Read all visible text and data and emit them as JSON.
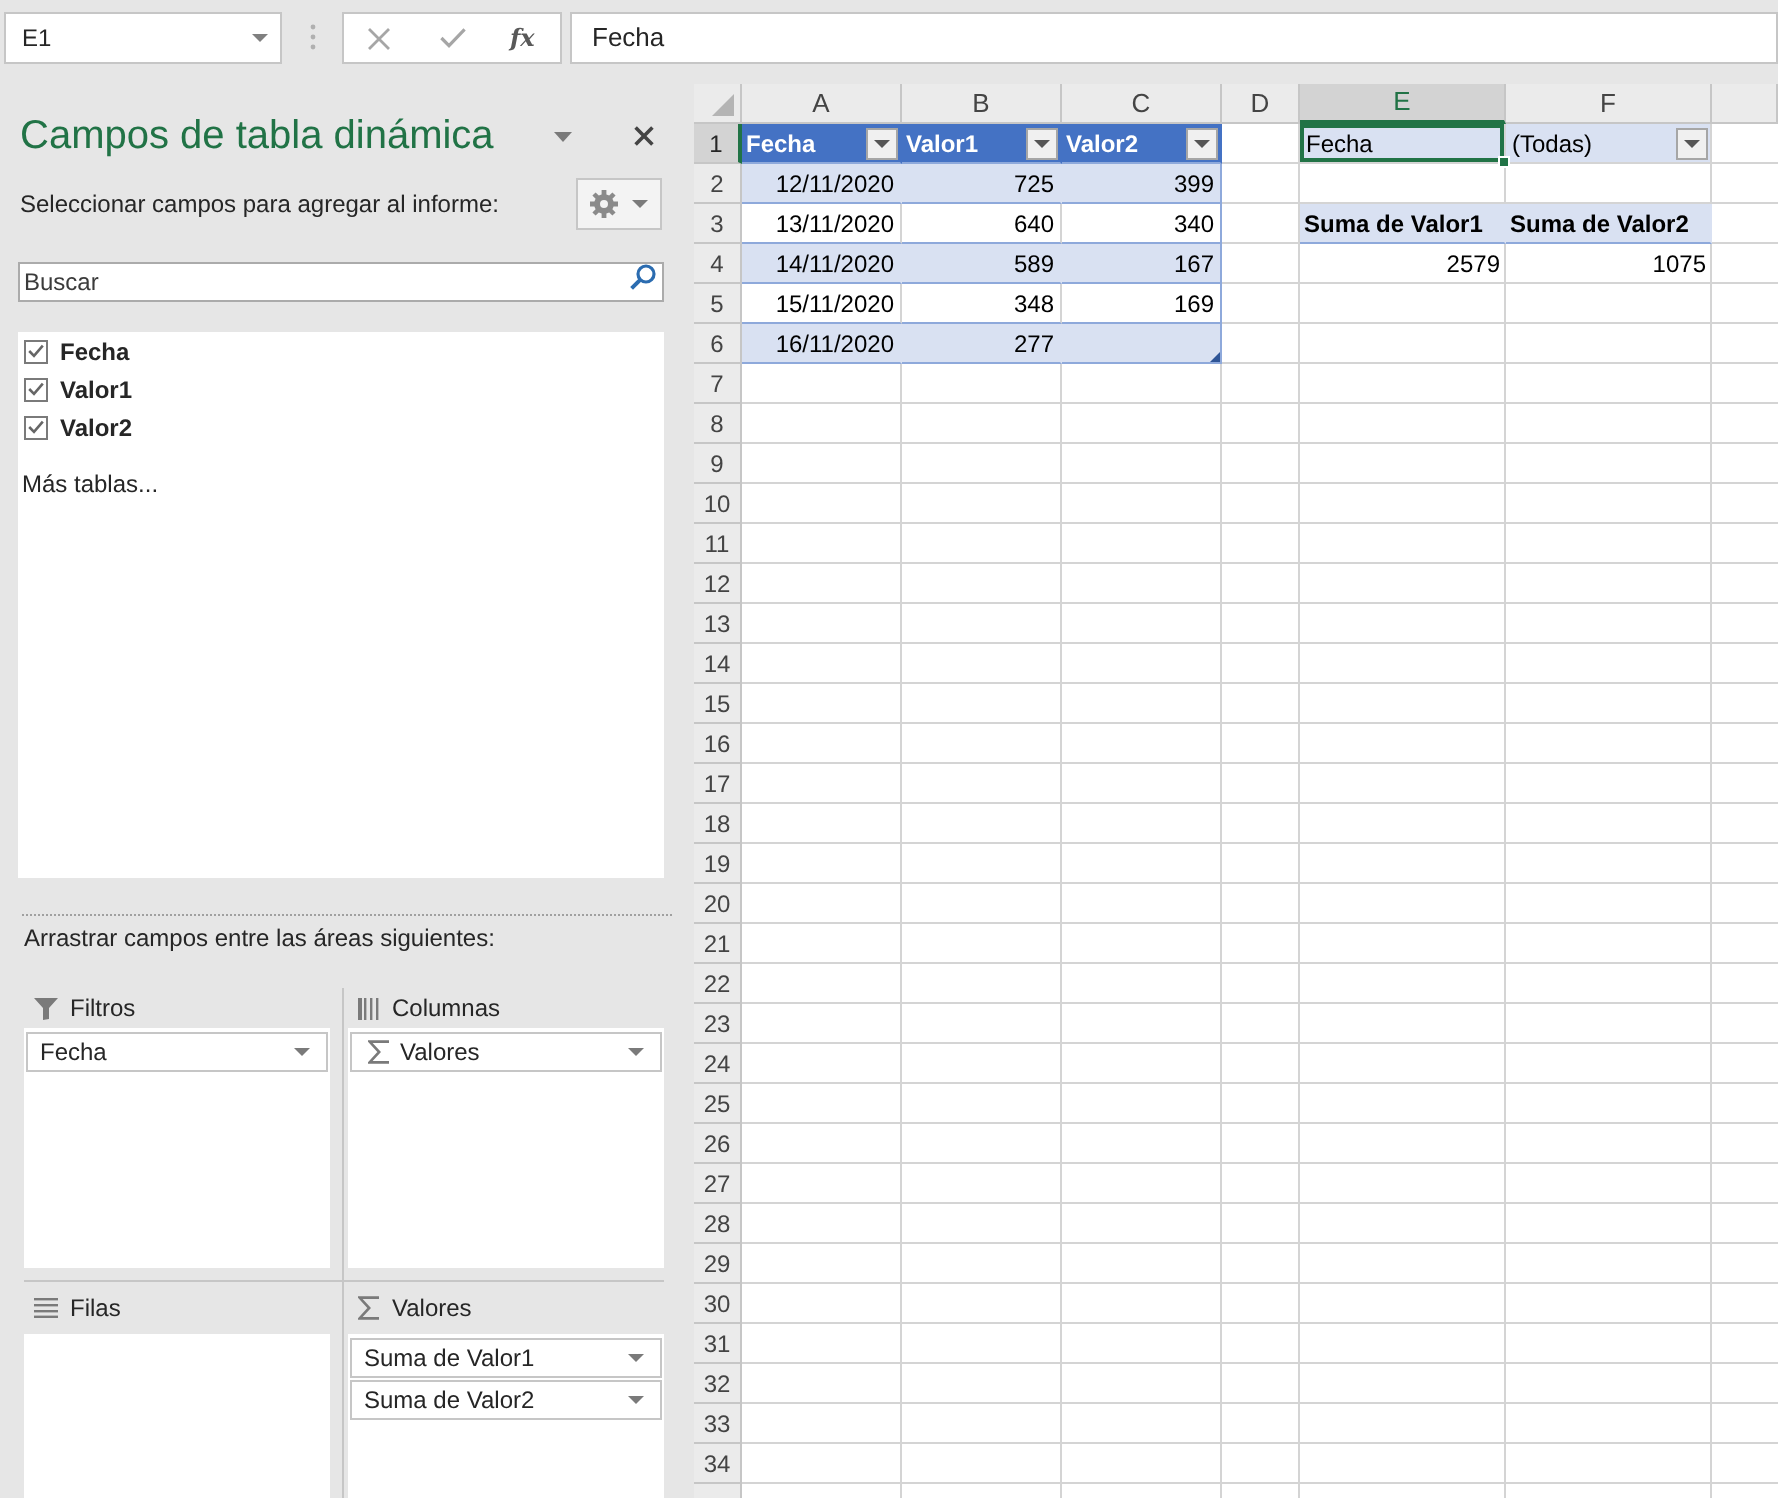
{
  "name_box": {
    "value": "E1"
  },
  "formula_bar": {
    "function_label": "fx",
    "value": "Fecha"
  },
  "pivot_panel": {
    "title": "Campos de tabla dinámica",
    "subtitle": "Seleccionar campos para agregar al informe:",
    "search": {
      "placeholder": "Buscar"
    },
    "fields": [
      {
        "label": "Fecha",
        "checked": true
      },
      {
        "label": "Valor1",
        "checked": true
      },
      {
        "label": "Valor2",
        "checked": true
      }
    ],
    "more_tables": "Más tablas...",
    "areas_hint": "Arrastrar campos entre las áreas siguientes:",
    "areas": [
      {
        "kind": "filters",
        "label": "Filtros",
        "items": [
          {
            "kind": "field",
            "label": "Fecha"
          }
        ]
      },
      {
        "kind": "columns",
        "label": "Columnas",
        "items": [
          {
            "kind": "values",
            "label": "Valores"
          }
        ]
      },
      {
        "kind": "rows",
        "label": "Filas"
      },
      {
        "kind": "values",
        "label": "Valores",
        "items": [
          {
            "kind": "field",
            "label": "Suma de Valor1"
          },
          {
            "kind": "field",
            "label": "Suma de Valor2"
          }
        ]
      }
    ]
  },
  "sheet": {
    "columns": [
      {
        "label": "A",
        "selected": false
      },
      {
        "label": "B",
        "selected": false
      },
      {
        "label": "C",
        "selected": false
      },
      {
        "label": "D",
        "selected": false
      },
      {
        "label": "E",
        "selected": true
      },
      {
        "label": "F",
        "selected": false
      }
    ],
    "rows": [
      {
        "label": "1",
        "selected": true
      },
      {
        "label": "2",
        "selected": false
      },
      {
        "label": "3",
        "selected": false
      },
      {
        "label": "4",
        "selected": false
      },
      {
        "label": "5",
        "selected": false
      },
      {
        "label": "6",
        "selected": false
      },
      {
        "label": "7",
        "selected": false
      },
      {
        "label": "8",
        "selected": false
      },
      {
        "label": "9",
        "selected": false
      },
      {
        "label": "10",
        "selected": false
      },
      {
        "label": "11",
        "selected": false
      },
      {
        "label": "12",
        "selected": false
      },
      {
        "label": "13",
        "selected": false
      },
      {
        "label": "14",
        "selected": false
      },
      {
        "label": "15",
        "selected": false
      },
      {
        "label": "16",
        "selected": false
      },
      {
        "label": "17",
        "selected": false
      },
      {
        "label": "18",
        "selected": false
      },
      {
        "label": "19",
        "selected": false
      },
      {
        "label": "20",
        "selected": false
      },
      {
        "label": "21",
        "selected": false
      },
      {
        "label": "22",
        "selected": false
      },
      {
        "label": "23",
        "selected": false
      },
      {
        "label": "24",
        "selected": false
      },
      {
        "label": "25",
        "selected": false
      },
      {
        "label": "26",
        "selected": false
      },
      {
        "label": "27",
        "selected": false
      },
      {
        "label": "28",
        "selected": false
      },
      {
        "label": "29",
        "selected": false
      },
      {
        "label": "30",
        "selected": false
      },
      {
        "label": "31",
        "selected": false
      },
      {
        "label": "32",
        "selected": false
      },
      {
        "label": "33",
        "selected": false
      },
      {
        "label": "34",
        "selected": false
      }
    ],
    "table": {
      "headers": [
        "Fecha",
        "Valor1",
        "Valor2"
      ],
      "rows": [
        [
          "12/11/2020",
          "725",
          "399"
        ],
        [
          "13/11/2020",
          "640",
          "340"
        ],
        [
          "14/11/2020",
          "589",
          "167"
        ],
        [
          "15/11/2020",
          "348",
          "169"
        ],
        [
          "16/11/2020",
          "277"
        ]
      ]
    },
    "pivot": {
      "filter_field": {
        "label": "Fecha",
        "selected": true
      },
      "filter_value": "(Todas)",
      "value_headers": [
        "Suma de Valor1",
        "Suma de Valor2"
      ],
      "totals": [
        "2579",
        "1075"
      ]
    }
  }
}
